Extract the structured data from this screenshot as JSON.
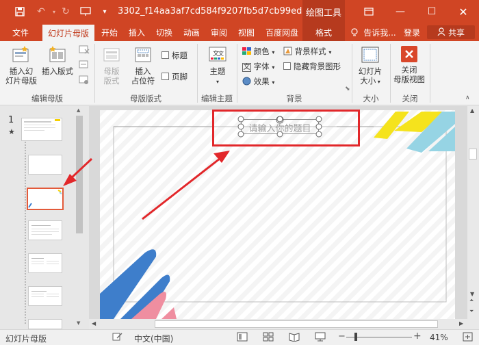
{
  "titlebar": {
    "doc_title": "3302_f14aa3af7cd584f9207fb5d7cb99edc...",
    "context_tools": "绘图工具",
    "qa_icons": [
      "save-icon",
      "undo-icon",
      "redo-icon",
      "present-icon",
      "customize-icon"
    ]
  },
  "tabs": {
    "file": "文件",
    "slide_master": "幻灯片母版",
    "home": "开始",
    "insert": "插入",
    "transitions": "切换",
    "animations": "动画",
    "review": "审阅",
    "view": "视图",
    "baidu": "百度网盘",
    "format": "格式",
    "tell_me": "告诉我...",
    "login": "登录",
    "share": "共享"
  },
  "ribbon": {
    "insert_master_l1": "插入幻",
    "insert_master_l2": "灯片母版",
    "insert_layout": "插入版式",
    "master_layout_l1": "母版",
    "master_layout_l2": "版式",
    "insert_placeholder_l1": "插入",
    "insert_placeholder_l2": "占位符",
    "title_chk": "标题",
    "footer_chk": "页脚",
    "theme": "主题",
    "colors": "颜色",
    "fonts": "字体",
    "effects": "效果",
    "bg_styles": "背景样式",
    "hide_bg": "隐藏背景图形",
    "slide_size_l1": "幻灯片",
    "slide_size_l2": "大小",
    "close_l1": "关闭",
    "close_l2": "母版视图",
    "group_edit_master": "编辑母版",
    "group_master_layout": "母版版式",
    "group_edit_theme": "编辑主题",
    "group_background": "背景",
    "group_size": "大小",
    "group_close": "关闭"
  },
  "leftpane": {
    "slide_number": "1",
    "star": "★"
  },
  "slide": {
    "title_placeholder": "请输入你的题目"
  },
  "statusbar": {
    "view_name": "幻灯片母版",
    "language": "中文(中国)",
    "zoom": "41%"
  },
  "colors": {
    "accent": "#d04524",
    "accent_dark": "#b63a1e",
    "annotation": "#e2272a"
  }
}
